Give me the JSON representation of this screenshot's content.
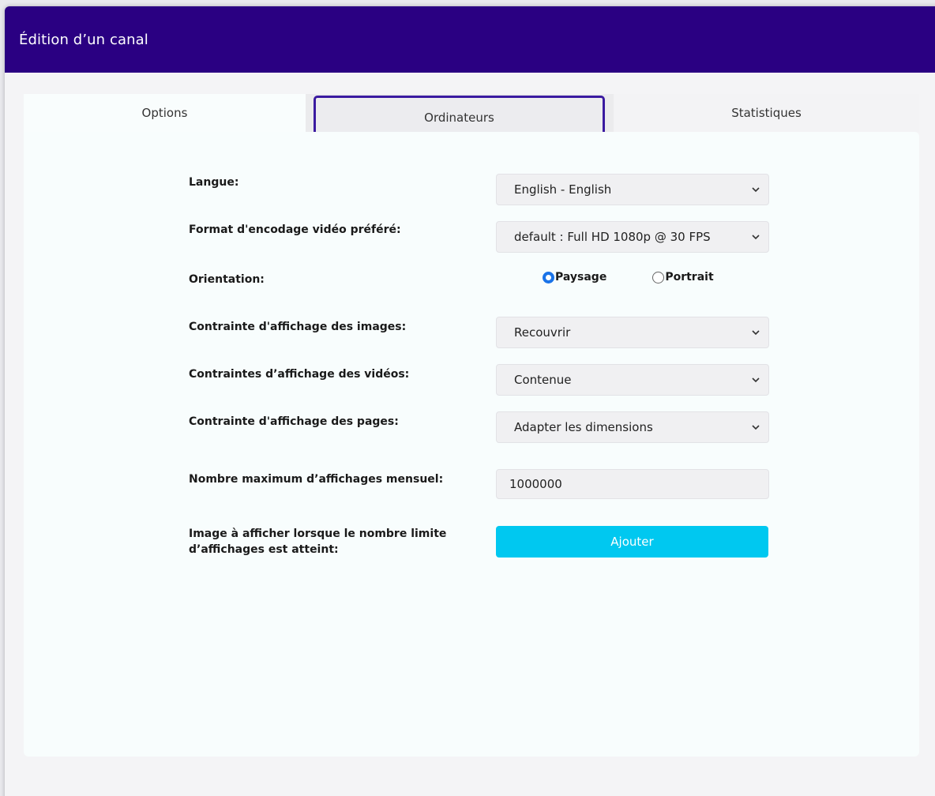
{
  "header": {
    "title": "Édition d’un canal"
  },
  "tabs": [
    {
      "label": "Options"
    },
    {
      "label": "Ordinateurs"
    },
    {
      "label": "Statistiques"
    }
  ],
  "form": {
    "language": {
      "label": "Langue:",
      "value": "English - English"
    },
    "encoding": {
      "label": "Format d'encodage vidéo préféré:",
      "value": "default : Full HD 1080p @ 30 FPS"
    },
    "orientation": {
      "label": "Orientation:",
      "options": [
        "Paysage",
        "Portrait"
      ],
      "selected": "Paysage"
    },
    "image_constraint": {
      "label": "Contrainte d'affichage des images:",
      "value": "Recouvrir"
    },
    "video_constraint": {
      "label": "Contraintes d’affichage des vidéos:",
      "value": "Contenue"
    },
    "page_constraint": {
      "label": "Contrainte d'affichage des pages:",
      "value": "Adapter les dimensions"
    },
    "max_views": {
      "label": "Nombre maximum d’affichages mensuel:",
      "value": "1000000"
    },
    "limit_image": {
      "label_line1": "Image à afficher lorsque le nombre limite",
      "label_line2": "d’affichages est atteint:",
      "button_label": "Ajouter"
    }
  },
  "colors": {
    "header_bg": "#2a0082",
    "accent_button": "#00c8f0",
    "radio_checked": "#1a73e8"
  },
  "icons": {
    "select_arrow": "chevron-down-icon"
  }
}
